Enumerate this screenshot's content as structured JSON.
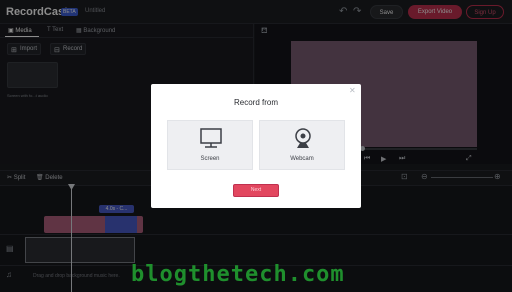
{
  "header": {
    "logo": "RecordCast",
    "beta": "BETA",
    "doc_title": "Untitled",
    "save_label": "Save",
    "export_label": "Export Video",
    "signup_label": "Sign Up"
  },
  "left_panel": {
    "tabs": [
      {
        "label": "Media",
        "active": true
      },
      {
        "label": "Text",
        "active": false
      },
      {
        "label": "Background",
        "active": false
      }
    ],
    "import_label": "Import",
    "record_label": "Record",
    "thumb_label": "Screen with fo...t audio"
  },
  "timeline": {
    "split_label": "Split",
    "delete_label": "Delete",
    "clip_label": "4.0s - C...",
    "music_hint": "Drag and drop background music here."
  },
  "modal": {
    "title": "Record from",
    "options": [
      {
        "label": "Screen",
        "icon": "monitor-icon"
      },
      {
        "label": "Webcam",
        "icon": "webcam-icon"
      }
    ],
    "next_label": "Next"
  },
  "watermark": "blogthetech.com",
  "colors": {
    "accent": "#c0304f",
    "preview": "#7a5e74",
    "clip_blue": "#4a5cc8",
    "clip_pink": "#b0607c"
  }
}
